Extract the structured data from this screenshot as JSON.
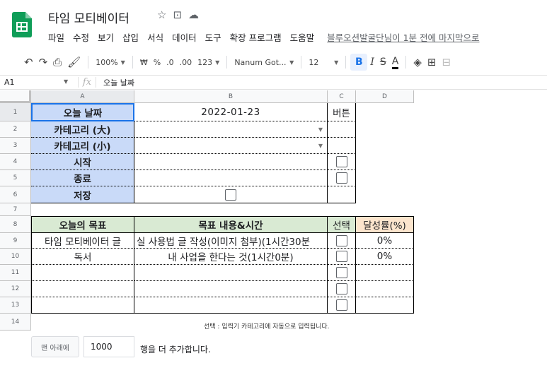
{
  "doc": {
    "title": "타임 모티베이터",
    "star_icon": "star-icon",
    "move_icon": "move-folder-icon",
    "cloud_icon": "cloud-status-icon"
  },
  "menu": [
    "파일",
    "수정",
    "보기",
    "삽입",
    "서식",
    "데이터",
    "도구",
    "확장 프로그램",
    "도움말"
  ],
  "last_edit": "블루오션발굴단님이 1분 전에 마지막으로",
  "toolbar": {
    "zoom": "100%",
    "currency": "₩",
    "percent": "%",
    "dec_less": ".0",
    "dec_more": ".00",
    "number_format": "123",
    "font": "Nanum Got...",
    "font_size": "12",
    "bold": "B",
    "italic": "I",
    "strike": "S",
    "text_color": "A"
  },
  "formula": {
    "cell_ref": "A1",
    "fx": "fx",
    "content": "오늘 날짜"
  },
  "columns": [
    "A",
    "B",
    "C",
    "D"
  ],
  "rows": [
    "1",
    "2",
    "3",
    "4",
    "5",
    "6",
    "7",
    "8",
    "9",
    "10",
    "11",
    "12",
    "13",
    "14"
  ],
  "sheet": {
    "r1": {
      "a": "오늘 날짜",
      "b": "2022-01-23",
      "c": "버튼"
    },
    "r2": {
      "a": "카테고리 (大)"
    },
    "r3": {
      "a": "카테고리 (小)"
    },
    "r4": {
      "a": "시작"
    },
    "r5": {
      "a": "종료"
    },
    "r6": {
      "a": "저장"
    },
    "r8": {
      "a": "오늘의 목표",
      "b": "목표 내용&시간",
      "c": "선택",
      "d": "달성률(%)"
    },
    "r9": {
      "a": "타임 모티베이터 글",
      "b": "실 사용법 글 작성(이미지 첨부)(1시간30분",
      "d": "0%"
    },
    "r10": {
      "a": "독서",
      "b": "내 사업을 한다는 것(1시간0분)",
      "d": "0%"
    },
    "note": "선택 : 입력기 카테고리에 자동으로 입력됩니다."
  },
  "footer": {
    "add_button": "맨 아래에",
    "rows_value": "1000",
    "suffix": "행을 더 추가합니다."
  }
}
